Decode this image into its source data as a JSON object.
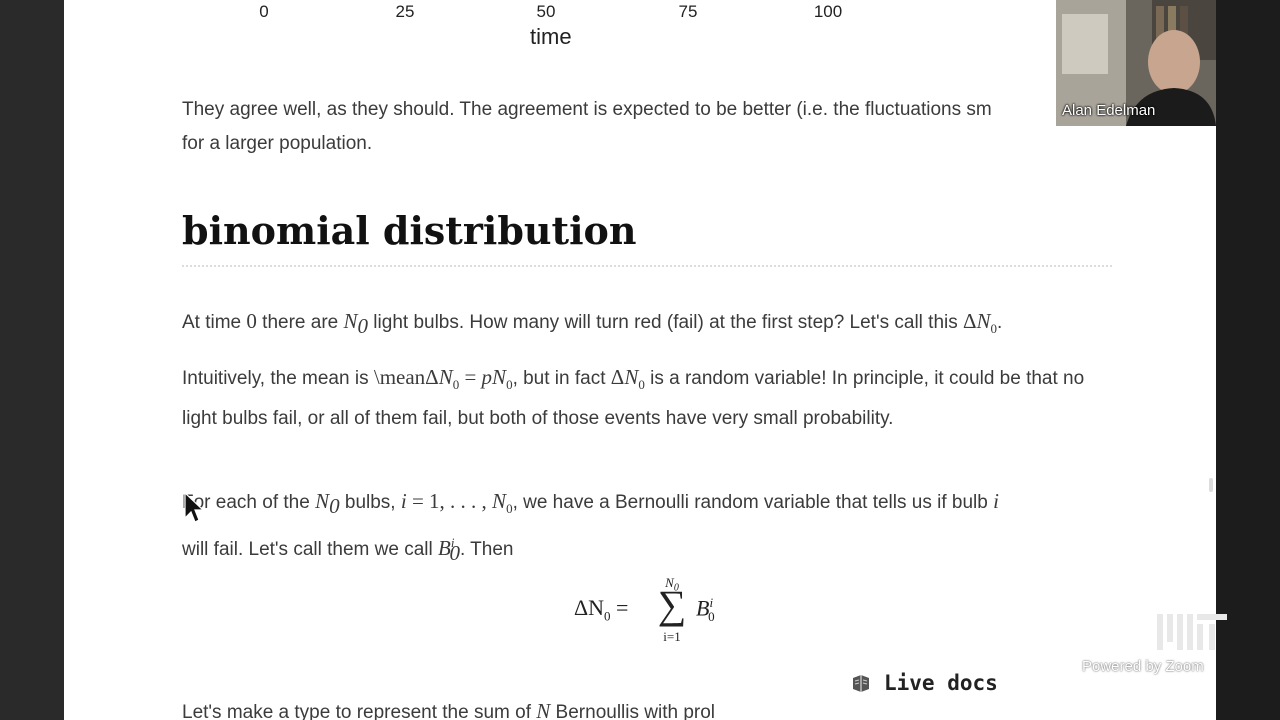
{
  "chart_axis": {
    "ticks": [
      "0",
      "25",
      "50",
      "75",
      "100"
    ],
    "xlabel": "time"
  },
  "paragraphs": {
    "agree_line1": "They agree well, as they should. The agreement is expected to be better (i.e. the fluctuations sm",
    "agree_line2": "for a larger population.",
    "p1_a": "At time ",
    "p1_b": "0",
    "p1_c": " there are ",
    "p1_d": " light bulbs. How many will turn red (fail) at the first step? Let's call this ",
    "p1_e": ".",
    "p2_a": "Intuitively, the mean is ",
    "p2_b": "\\mean",
    "p2_c": ", but in fact ",
    "p2_d": " is a random variable! In principle, it could be that no light bulbs fail, or all of them fail, but both of those events have very small probability.",
    "p3_a": "For each of the ",
    "p3_b": " bulbs, ",
    "p3_c": ", we have a Bernoulli random variable that tells us if bulb ",
    "p3_d": "will fail. Let's call them we call ",
    "p3_e": ". Then",
    "p4_a": "Let's make a type to represent the sum of ",
    "p4_b": " Bernoullis with prol"
  },
  "heading": "binomial distribution",
  "equation": {
    "lhs": "ΔN",
    "sub": "0",
    "equals": "=",
    "sum_upper": "N",
    "sum_lower": "i=1",
    "rhs": "B"
  },
  "live_docs": {
    "label": "Live docs",
    "icon": "book-icon"
  },
  "video": {
    "presenter": "Alan Edelman"
  },
  "overlay": {
    "powered_by": "Powered by Zoom",
    "logo": "mit-logo"
  }
}
